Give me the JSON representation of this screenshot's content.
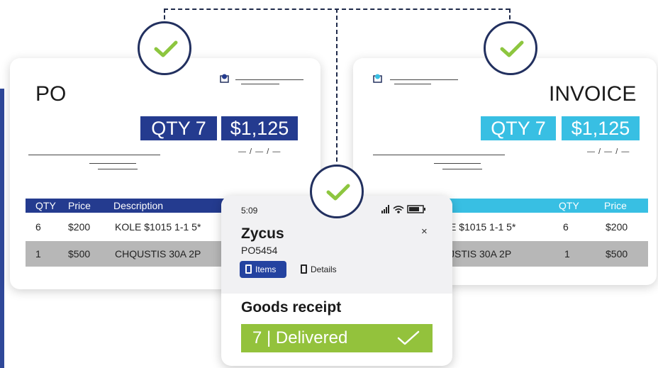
{
  "colors": {
    "navy": "#243b8f",
    "cyan": "#38bfe3",
    "green": "#93c23c",
    "check_green": "#8dc63f",
    "ring": "#22305f"
  },
  "po": {
    "title": "PO",
    "qty": "QTY 7",
    "amount": "$1,125",
    "date": "— / — / —",
    "table": {
      "headers": [
        "QTY",
        "Price",
        "Description"
      ],
      "rows": [
        [
          "6",
          "$200",
          "KOLE $1015 1-1 5*"
        ],
        [
          "1",
          "$500",
          "CHQUSTIS  30A 2P"
        ]
      ]
    }
  },
  "invoice": {
    "title": "INVOICE",
    "qty": "QTY 7",
    "amount": "$1,125",
    "date": "— / — / —",
    "table": {
      "headers": [
        "QTY",
        "Price"
      ],
      "rows": [
        [
          "E $1015 1-1 5*",
          "6",
          "$200"
        ],
        [
          "JSTIS  30A 2P",
          "1",
          "$500"
        ]
      ]
    }
  },
  "phone": {
    "time": "5:09",
    "app_name": "Zycus",
    "po_number": "PO5454",
    "close_label": "×",
    "tabs": {
      "items": "Items",
      "details": "Details"
    },
    "section_title": "Goods receipt",
    "delivered_text": "7 | Delivered"
  },
  "icons": [
    "check-icon",
    "document-icon",
    "signal-icon",
    "wifi-icon",
    "battery-icon",
    "close-icon"
  ]
}
